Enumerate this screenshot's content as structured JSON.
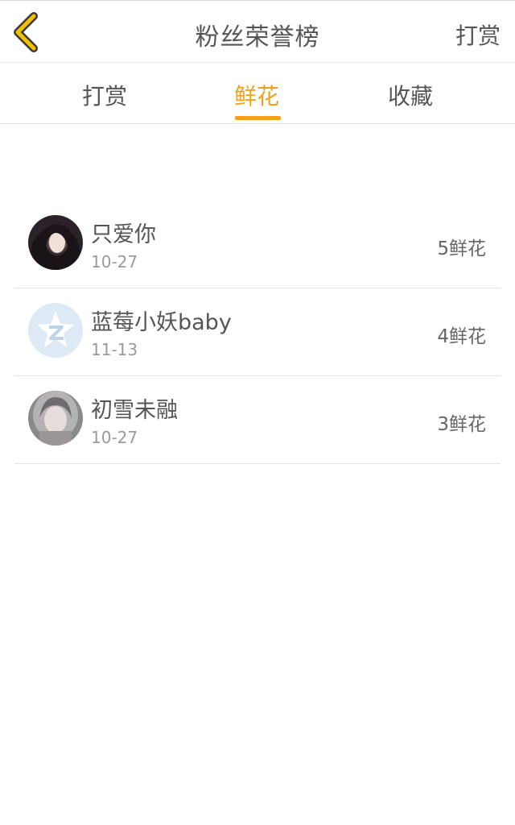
{
  "header": {
    "title": "粉丝荣誉榜",
    "right_link": "打赏",
    "back_icon": "chevron-left-icon",
    "accent_color": "#f4a018"
  },
  "tabs": [
    {
      "label": "打赏",
      "active": false
    },
    {
      "label": "鲜花",
      "active": true
    },
    {
      "label": "收藏",
      "active": false
    }
  ],
  "list": [
    {
      "name": "只爱你",
      "date": "10-27",
      "count": "5鲜花",
      "avatar": "photo-avatar"
    },
    {
      "name": "蓝莓小妖baby",
      "date": "11-13",
      "count": "4鲜花",
      "avatar": "qq-default-avatar"
    },
    {
      "name": "初雪未融",
      "date": "10-27",
      "count": "3鲜花",
      "avatar": "photo-avatar"
    }
  ]
}
